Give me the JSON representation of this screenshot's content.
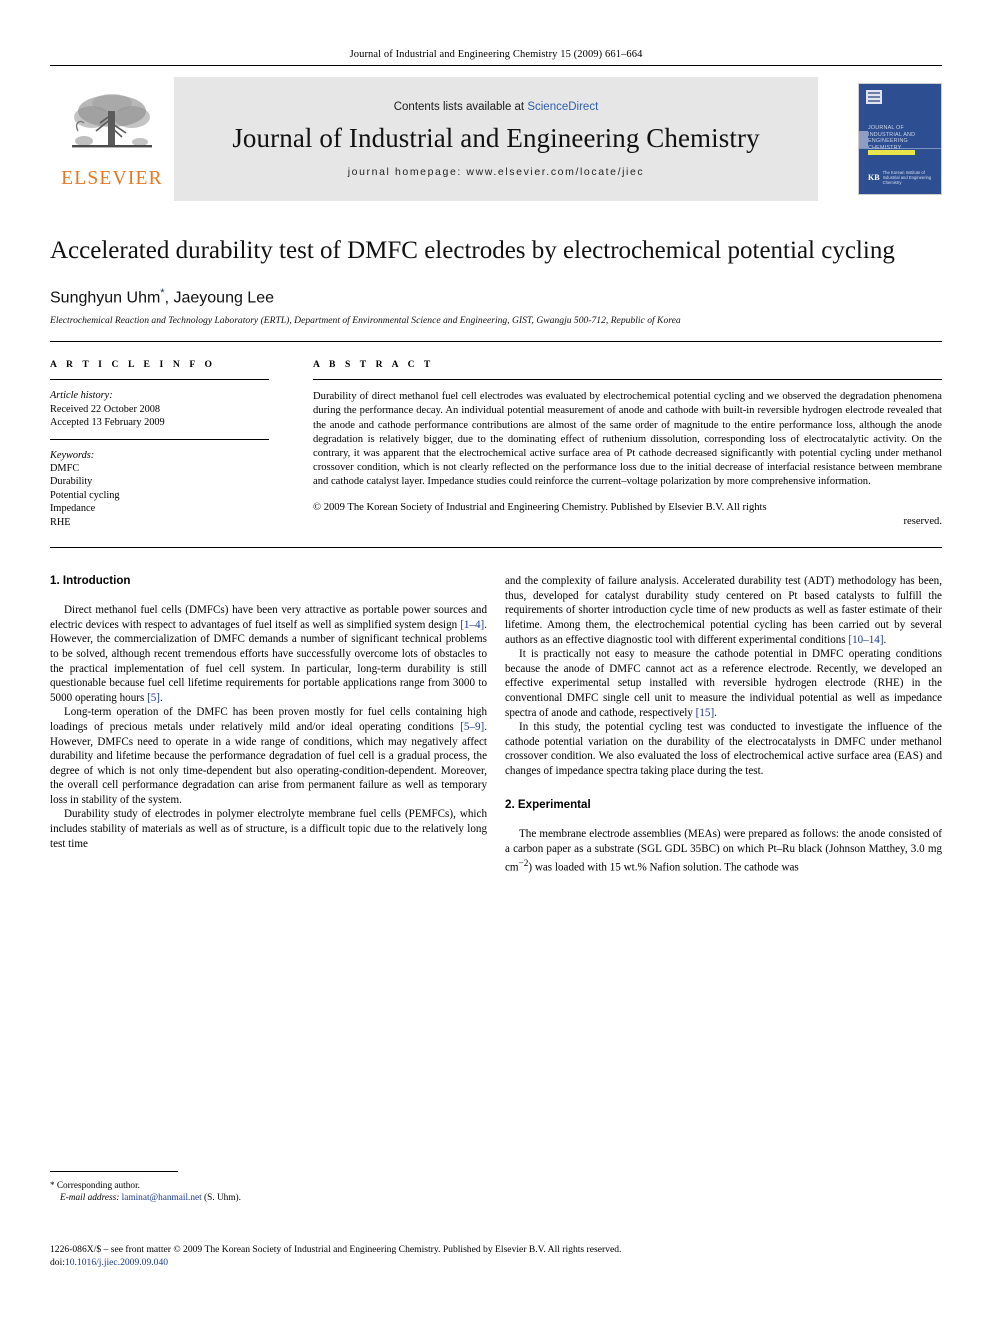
{
  "running_head": "Journal of Industrial and Engineering Chemistry 15 (2009) 661–664",
  "masthead": {
    "contents_prefix": "Contents lists available at",
    "contents_link": "ScienceDirect",
    "journal_name": "Journal of Industrial and Engineering Chemistry",
    "homepage": "journal homepage: www.elsevier.com/locate/jiec",
    "publisher_logo_text": "ELSEVIER",
    "cover": {
      "title_lines": "Journal of Industrial and Engineering Chemistry",
      "society_mark": "KB",
      "society_text": "The Korean Institute of Industrial and Engineering Chemistry"
    }
  },
  "article": {
    "title": "Accelerated durability test of DMFC electrodes by electrochemical potential cycling",
    "authors": "Sunghyun Uhm",
    "author_marker": "*",
    "authors_rest": ", Jaeyoung Lee",
    "affiliation": "Electrochemical Reaction and Technology Laboratory (ERTL), Department of Environmental Science and Engineering, GIST, Gwangju 500-712, Republic of Korea"
  },
  "article_info": {
    "heading": "A R T I C L E   I N F O",
    "history_label": "Article history:",
    "received": "Received 22 October 2008",
    "accepted": "Accepted 13 February 2009",
    "keywords_label": "Keywords:",
    "keywords": [
      "DMFC",
      "Durability",
      "Potential cycling",
      "Impedance",
      "RHE"
    ]
  },
  "abstract": {
    "heading": "A B S T R A C T",
    "text": "Durability of direct methanol fuel cell electrodes was evaluated by electrochemical potential cycling and we observed the degradation phenomena during the performance decay. An individual potential measurement of anode and cathode with built-in reversible hydrogen electrode revealed that the anode and cathode performance contributions are almost of the same order of magnitude to the entire performance loss, although the anode degradation is relatively bigger, due to the dominating effect of ruthenium dissolution, corresponding loss of electrocatalytic activity. On the contrary, it was apparent that the electrochemical active surface area of Pt cathode decreased significantly with potential cycling under methanol crossover condition, which is not clearly reflected on the performance loss due to the initial decrease of interfacial resistance between membrane and cathode catalyst layer. Impedance studies could reinforce the current–voltage polarization by more comprehensive information.",
    "copyright": "© 2009 The Korean Society of Industrial and Engineering Chemistry. Published by Elsevier B.V. All rights",
    "copyright_end": "reserved."
  },
  "sections": {
    "introduction_heading": "1. Introduction",
    "experimental_heading": "2. Experimental"
  },
  "left_column": {
    "p1_a": "Direct methanol fuel cells (DMFCs) have been very attractive as portable power sources and electric devices with respect to advantages of fuel itself as well as simplified system design ",
    "p1_ref1": "[1–4]",
    "p1_b": ". However, the commercialization of DMFC demands a number of significant technical problems to be solved, although recent tremendous efforts have successfully overcome lots of obstacles to the practical implementation of fuel cell system. In particular, long-term durability is still questionable because fuel cell lifetime requirements for portable applications range from 3000 to 5000 operating hours ",
    "p1_ref2": "[5]",
    "p1_c": ".",
    "p2_a": "Long-term operation of the DMFC has been proven mostly for fuel cells containing high loadings of precious metals under relatively mild and/or ideal operating conditions ",
    "p2_ref1": "[5–9]",
    "p2_b": ". However, DMFCs need to operate in a wide range of conditions, which may negatively affect durability and lifetime because the performance degradation of fuel cell is a gradual process, the degree of which is not only time-dependent but also operating-condition-dependent. Moreover, the overall cell performance degradation can arise from permanent failure as well as temporary loss in stability of the system.",
    "p3": "Durability study of electrodes in polymer electrolyte membrane fuel cells (PEMFCs), which includes stability of materials as well as of structure, is a difficult topic due to the relatively long test time"
  },
  "right_column": {
    "p1_a": "and the complexity of failure analysis. Accelerated durability test (ADT) methodology has been, thus, developed for catalyst durability study centered on Pt based catalysts to fulfill the requirements of shorter introduction cycle time of new products as well as faster estimate of their lifetime. Among them, the electrochemical potential cycling has been carried out by several authors as an effective diagnostic tool with different experimental conditions ",
    "p1_ref": "[10–14]",
    "p1_b": ".",
    "p2_a": "It is practically not easy to measure the cathode potential in DMFC operating conditions because the anode of DMFC cannot act as a reference electrode. Recently, we developed an effective experimental setup installed with reversible hydrogen electrode (RHE) in the conventional DMFC single cell unit to measure the individual potential as well as impedance spectra of anode and cathode, respectively ",
    "p2_ref": "[15]",
    "p2_b": ".",
    "p3": "In this study, the potential cycling test was conducted to investigate the influence of the cathode potential variation on the durability of the electrocatalysts in DMFC under methanol crossover condition. We also evaluated the loss of electrochemical active surface area (EAS) and changes of impedance spectra taking place during the test.",
    "p4_a": "The membrane electrode assemblies (MEAs) were prepared as follows: the anode consisted of a carbon paper as a substrate (SGL GDL 35BC) on which Pt–Ru black (Johnson Matthey, 3.0 mg cm",
    "p4_sup": "−2",
    "p4_b": ") was loaded with 15 wt.% Nafion solution. The cathode was"
  },
  "footnote": {
    "star": "*",
    "corresponding": "Corresponding author.",
    "email_label": "E-mail address:",
    "email": "laminat@hanmail.net",
    "email_owner": "(S. Uhm)."
  },
  "page_footer": {
    "line1": "1226-086X/$ – see front matter © 2009 The Korean Society of Industrial and Engineering Chemistry. Published by Elsevier B.V. All rights reserved.",
    "doi_label": "doi:",
    "doi": "10.1016/j.jiec.2009.09.040"
  }
}
